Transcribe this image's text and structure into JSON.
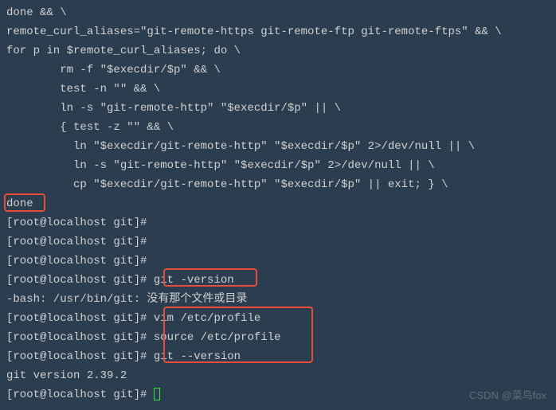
{
  "lines": {
    "l0": "done && \\",
    "l1": "remote_curl_aliases=\"git-remote-https git-remote-ftp git-remote-ftps\" && \\",
    "l2": "for p in $remote_curl_aliases; do \\",
    "l3": "        rm -f \"$execdir/$p\" && \\",
    "l4": "        test -n \"\" && \\",
    "l5": "        ln -s \"git-remote-http\" \"$execdir/$p\" || \\",
    "l6": "        { test -z \"\" && \\",
    "l7": "          ln \"$execdir/git-remote-http\" \"$execdir/$p\" 2>/dev/null || \\",
    "l8": "          ln -s \"git-remote-http\" \"$execdir/$p\" 2>/dev/null || \\",
    "l9": "          cp \"$execdir/git-remote-http\" \"$execdir/$p\" || exit; } \\",
    "l10": "done",
    "l11": "[root@localhost git]#",
    "l12": "[root@localhost git]#",
    "l13": "[root@localhost git]#",
    "l14a": "[root@localhost git]# ",
    "l14b": "git -version",
    "l15": "-bash: /usr/bin/git: 没有那个文件或目录",
    "l16a": "[root@localhost git]# ",
    "l16b": "vim /etc/profile",
    "l17a": "[root@localhost git]# ",
    "l17b": "source /etc/profile",
    "l18a": "[root@localhost git]# ",
    "l18b": "git --version",
    "l19": "git version 2.39.2",
    "l20": "[root@localhost git]# "
  },
  "watermark": "CSDN @菜鸟fox"
}
